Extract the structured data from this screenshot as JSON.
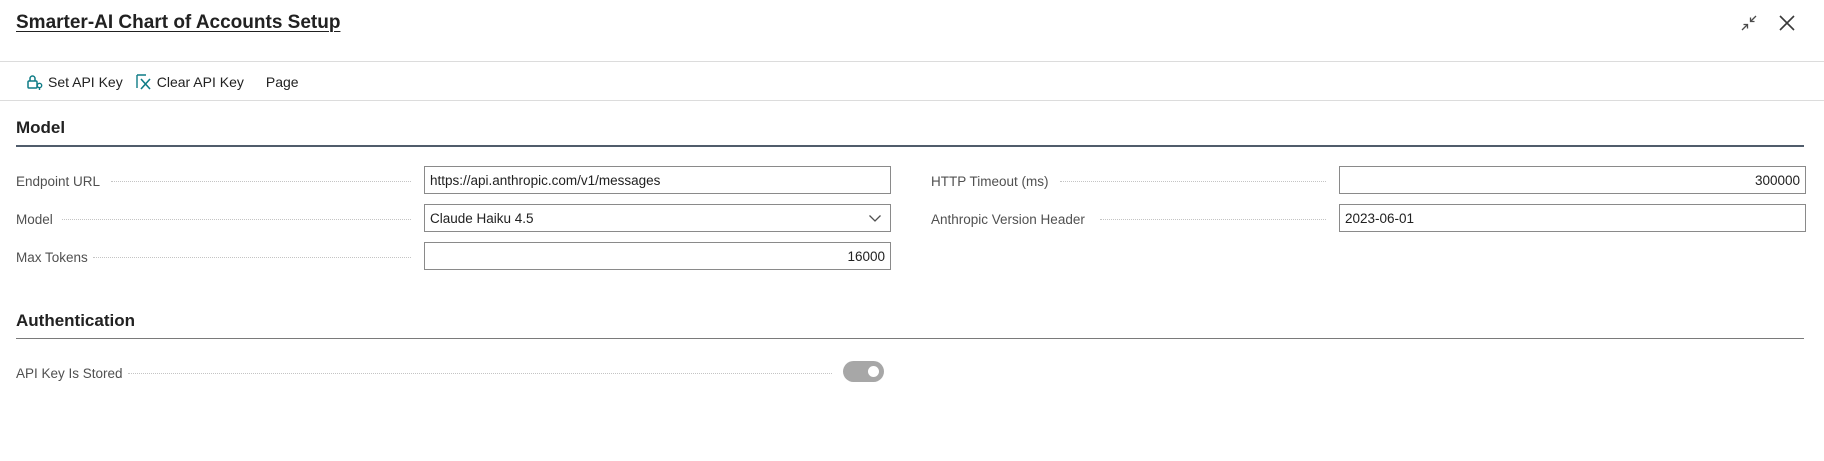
{
  "window": {
    "title": "Smarter-AI Chart of Accounts Setup"
  },
  "toolbar": {
    "set_api_key": "Set API Key",
    "clear_api_key": "Clear API Key",
    "page": "Page"
  },
  "sections": {
    "model": {
      "title": "Model",
      "fields": {
        "endpoint_url": {
          "label": "Endpoint URL",
          "value": "https://api.anthropic.com/v1/messages"
        },
        "model": {
          "label": "Model",
          "value": "Claude Haiku 4.5"
        },
        "max_tokens": {
          "label": "Max Tokens",
          "value": "16000"
        },
        "http_timeout": {
          "label": "HTTP Timeout (ms)",
          "value": "300000"
        },
        "anthropic_version": {
          "label": "Anthropic Version Header",
          "value": "2023-06-01"
        }
      }
    },
    "authentication": {
      "title": "Authentication",
      "fields": {
        "api_key_stored": {
          "label": "API Key Is Stored",
          "value": true
        }
      }
    }
  },
  "colors": {
    "accent_teal": "#0f7c86",
    "section_rule": "#505c6b",
    "toggle_off": "#a7a7a7"
  },
  "icons": {
    "set_api_key": "lock-key-icon",
    "clear_api_key": "clear-x-icon",
    "collapse": "collapse-arrows-icon",
    "close": "close-icon",
    "dropdown": "chevron-down-icon"
  }
}
